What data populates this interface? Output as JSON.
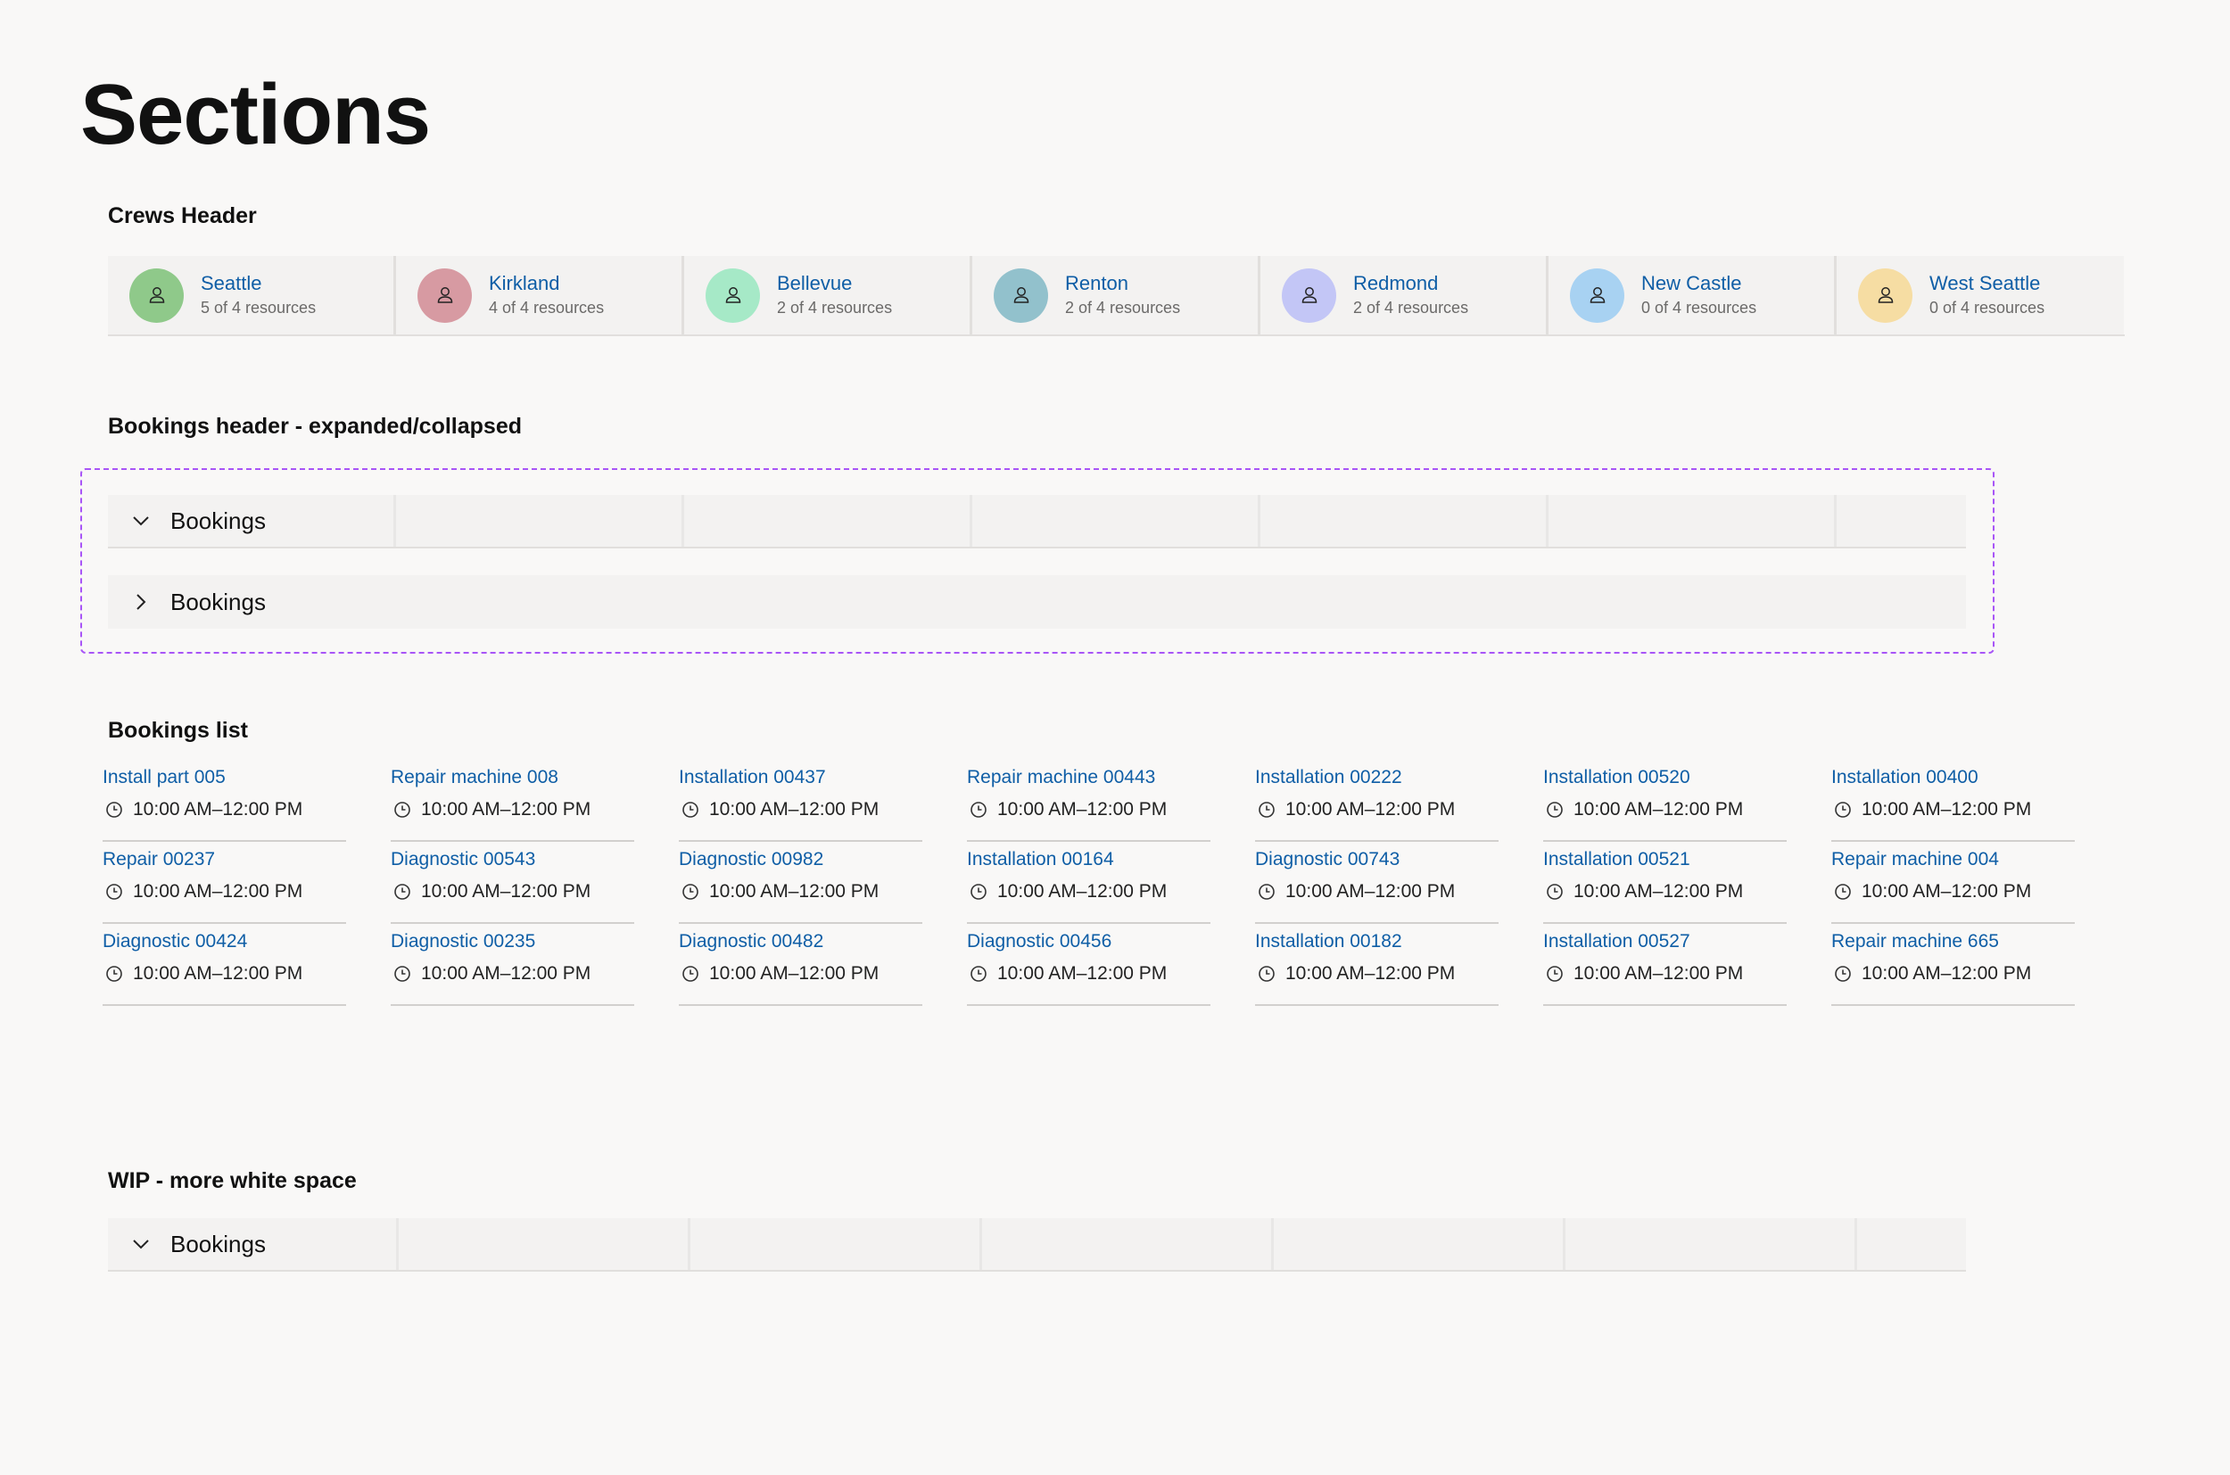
{
  "page_title": "Sections",
  "sections": {
    "crews_header": "Crews Header",
    "bookings_header": "Bookings header - expanded/collapsed",
    "bookings_list": "Bookings list",
    "wip": "WIP - more white space"
  },
  "crews": [
    {
      "name": "Seattle",
      "count": "5 of 4 resources",
      "color": "#8fc98a"
    },
    {
      "name": "Kirkland",
      "count": "4 of 4 resources",
      "color": "#d79aa2"
    },
    {
      "name": "Bellevue",
      "count": "2 of 4 resources",
      "color": "#a6e9c7"
    },
    {
      "name": "Renton",
      "count": "2 of 4 resources",
      "color": "#92c1cc"
    },
    {
      "name": "Redmond",
      "count": "2 of 4 resources",
      "color": "#c3c6f6"
    },
    {
      "name": "New Castle",
      "count": "0 of 4 resources",
      "color": "#a8d2f2"
    },
    {
      "name": "West Seattle",
      "count": "0 of 4 resources",
      "color": "#f6dda3"
    }
  ],
  "bookings_header": {
    "expanded_label": "Bookings",
    "collapsed_label": "Bookings",
    "wip_label": "Bookings"
  },
  "bookings": [
    [
      {
        "title": "Install part 005",
        "time": "10:00 AM–12:00 PM"
      },
      {
        "title": "Repair 00237",
        "time": "10:00 AM–12:00 PM"
      },
      {
        "title": "Diagnostic 00424",
        "time": "10:00 AM–12:00 PM"
      }
    ],
    [
      {
        "title": "Repair machine 008",
        "time": "10:00 AM–12:00 PM"
      },
      {
        "title": "Diagnostic 00543",
        "time": "10:00 AM–12:00 PM"
      },
      {
        "title": "Diagnostic 00235",
        "time": "10:00 AM–12:00 PM"
      }
    ],
    [
      {
        "title": "Installation 00437",
        "time": "10:00 AM–12:00 PM"
      },
      {
        "title": "Diagnostic 00982",
        "time": "10:00 AM–12:00 PM"
      },
      {
        "title": "Diagnostic 00482",
        "time": "10:00 AM–12:00 PM"
      }
    ],
    [
      {
        "title": "Repair machine 00443",
        "time": "10:00 AM–12:00 PM"
      },
      {
        "title": "Installation 00164",
        "time": "10:00 AM–12:00 PM"
      },
      {
        "title": "Diagnostic 00456",
        "time": "10:00 AM–12:00 PM"
      }
    ],
    [
      {
        "title": "Installation 00222",
        "time": "10:00 AM–12:00 PM"
      },
      {
        "title": "Diagnostic 00743",
        "time": "10:00 AM–12:00 PM"
      },
      {
        "title": "Installation 00182",
        "time": "10:00 AM–12:00 PM"
      }
    ],
    [
      {
        "title": "Installation 00520",
        "time": "10:00 AM–12:00 PM"
      },
      {
        "title": "Installation 00521",
        "time": "10:00 AM–12:00 PM"
      },
      {
        "title": "Installation 00527",
        "time": "10:00 AM–12:00 PM"
      }
    ],
    [
      {
        "title": "Installation 00400",
        "time": "10:00 AM–12:00 PM"
      },
      {
        "title": "Repair machine 004",
        "time": "10:00 AM–12:00 PM"
      },
      {
        "title": "Repair machine 665",
        "time": "10:00 AM–12:00 PM"
      }
    ]
  ]
}
